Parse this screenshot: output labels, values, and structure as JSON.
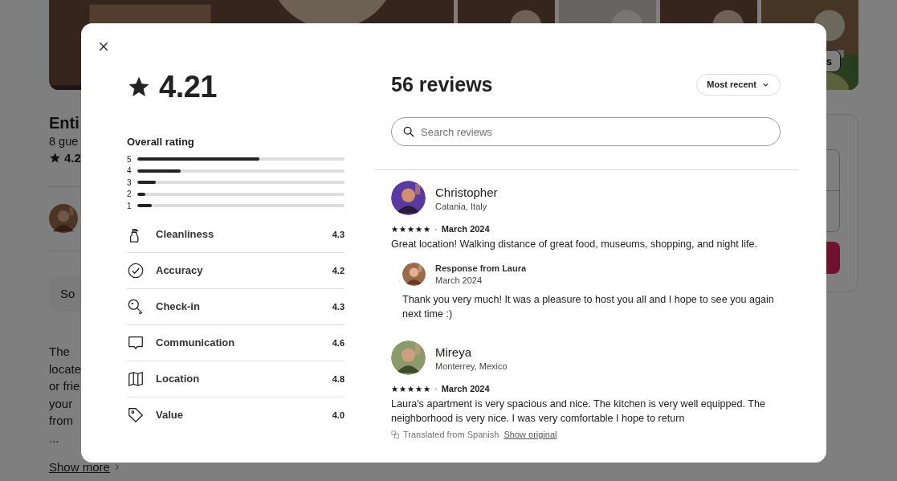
{
  "background_page": {
    "photo_button": "s",
    "title": "Enti",
    "subtitle": "8 gue",
    "rating": "4.2",
    "notice": "So",
    "description": [
      "The",
      "locate",
      "or frie",
      "your",
      "from",
      "..."
    ],
    "show_more": "Show more"
  },
  "modal": {
    "overall": {
      "score": "4.21",
      "heading": "Overall rating",
      "distribution": [
        {
          "label": "5",
          "level": 0.59
        },
        {
          "label": "4",
          "level": 0.21
        },
        {
          "label": "3",
          "level": 0.09
        },
        {
          "label": "2",
          "level": 0.04
        },
        {
          "label": "1",
          "level": 0.07
        }
      ]
    },
    "categories": [
      {
        "kind": "spray",
        "label": "Cleanliness",
        "score": "4.3"
      },
      {
        "kind": "check",
        "label": "Accuracy",
        "score": "4.2"
      },
      {
        "kind": "key",
        "label": "Check-in",
        "score": "4.3"
      },
      {
        "kind": "chat",
        "label": "Communication",
        "score": "4.6"
      },
      {
        "kind": "map",
        "label": "Location",
        "score": "4.8"
      },
      {
        "kind": "tag",
        "label": "Value",
        "score": "4.0"
      }
    ],
    "reviews_title": "56 reviews",
    "sort": {
      "label": "Most recent"
    },
    "search": {
      "placeholder": "Search reviews"
    },
    "reviews": [
      {
        "name": "Christopher",
        "location": "Catania, Italy",
        "stars": 5,
        "separator": "·",
        "date": "March 2024",
        "text": "Great location! Walking distance of great food, museums, shopping, and night life.",
        "response": {
          "title": "Response from Laura",
          "date": "March 2024",
          "text": "Thank you very much! It was a pleasure to host you all and I hope to see you again next time :)"
        }
      },
      {
        "name": "Mireya",
        "location": "Monterrey, Mexico",
        "stars": 5,
        "separator": "·",
        "date": "March 2024",
        "text": "Laura's apartment is very spacious and nice. The kitchen is very well equipped. The neighborhood is very nice. I was very comfortable I hope to return",
        "translation": {
          "note": "Translated from Spanish",
          "link": "Show original"
        }
      }
    ]
  }
}
